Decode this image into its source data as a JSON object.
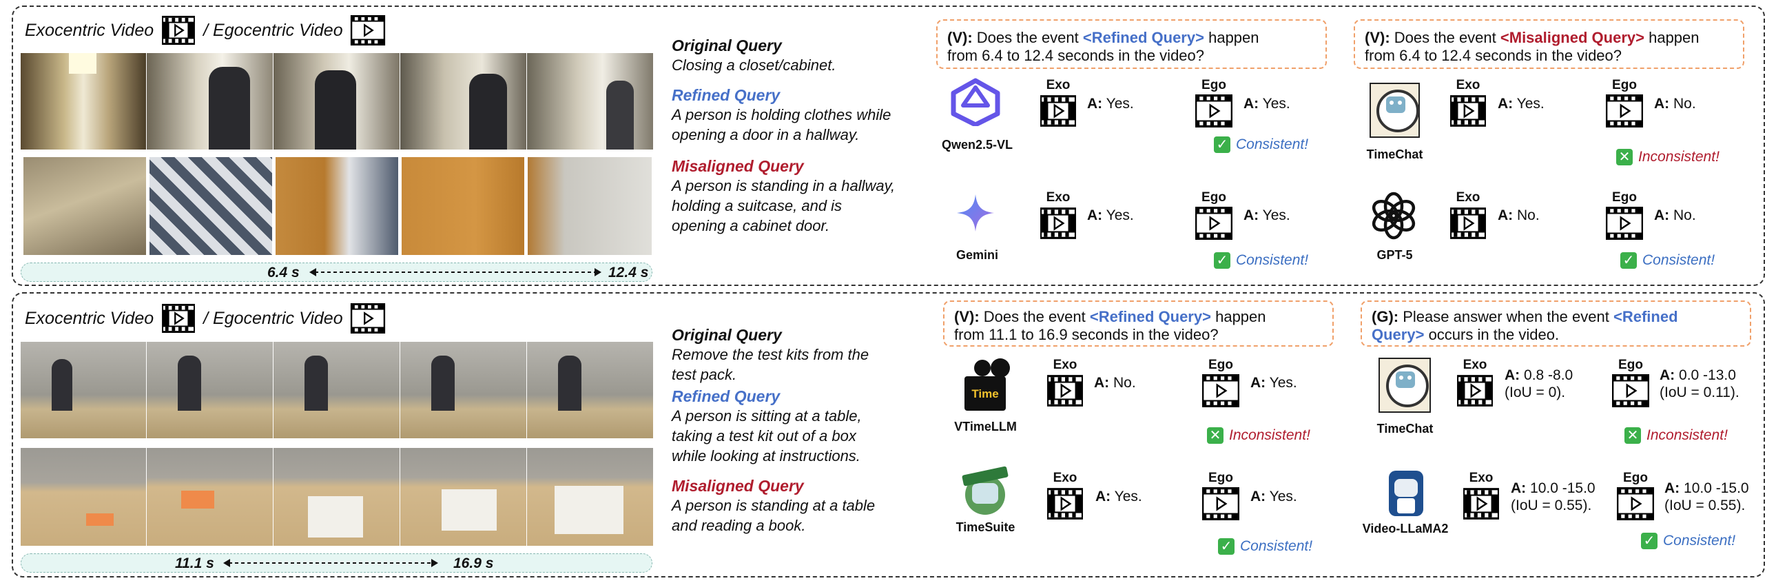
{
  "colors": {
    "refined": "#4670c8",
    "misaligned": "#b01d2e",
    "query_box_border": "#f0a06a",
    "timebar_bg": "#e6f6f3",
    "check_green": "#3bb04a"
  },
  "icons": {
    "video": "clapperboard-play-icon",
    "check": "check-mark-icon",
    "cross": "cross-mark-icon"
  },
  "panels": [
    {
      "header": {
        "exo": "Exocentric Video",
        "ego": "/ Egocentric Video"
      },
      "time": {
        "start": "6.4 s",
        "end": "12.4 s"
      },
      "original": {
        "title": "Original Query",
        "text": [
          "Closing a closet/cabinet."
        ]
      },
      "refined": {
        "title": "Refined Query",
        "text": [
          "A person is holding clothes while",
          "opening a door in a hallway."
        ]
      },
      "misaligned": {
        "title": "Misaligned Query",
        "text": [
          "A person is standing in a hallway,",
          "holding a suitcase, and is",
          "opening a cabinet door."
        ]
      },
      "questions": [
        {
          "prefix": "(V):",
          "pre": "Does the event",
          "tag": "<Refined Query>",
          "tag_type": "refined",
          "post": "happen",
          "line2": "from 6.4 to 12.4 seconds in the video?"
        },
        {
          "prefix": "(V):",
          "pre": "Does the event",
          "tag": "<Misaligned Query>",
          "tag_type": "misaligned",
          "post": "happen",
          "line2": "from 6.4 to 12.4 seconds in the video?"
        }
      ],
      "models": [
        {
          "name": "Qwen2.5-VL",
          "logo": "qwen-logo",
          "exo_answer": "Yes.",
          "ego_answer": "Yes.",
          "verdict": "Consistent!",
          "ok": true
        },
        {
          "name": "Gemini",
          "logo": "gemini-logo",
          "exo_answer": "Yes.",
          "ego_answer": "Yes.",
          "verdict": "Consistent!",
          "ok": true
        },
        {
          "name": "TimeChat",
          "logo": "timechat-logo",
          "exo_answer": "Yes.",
          "ego_answer": "No.",
          "verdict": "Inconsistent!",
          "ok": false
        },
        {
          "name": "GPT-5",
          "logo": "openai-logo",
          "exo_answer": "No.",
          "ego_answer": "No.",
          "verdict": "Consistent!",
          "ok": true
        }
      ]
    },
    {
      "header": {
        "exo": "Exocentric Video",
        "ego": "/ Egocentric Video"
      },
      "time": {
        "start": "11.1 s",
        "end": "16.9 s"
      },
      "original": {
        "title": "Original Query",
        "text": [
          "Remove the test kits from the",
          "test pack."
        ]
      },
      "refined": {
        "title": "Refined Query",
        "text": [
          "A person is sitting at a table,",
          "taking a test kit out of a box",
          "while looking at instructions."
        ]
      },
      "misaligned": {
        "title": "Misaligned Query",
        "text": [
          "A person is standing at a table",
          "and reading a book."
        ]
      },
      "questions": [
        {
          "prefix": "(V):",
          "pre": "Does the event",
          "tag": "<Refined Query>",
          "tag_type": "refined",
          "post": "happen",
          "line2": "from 11.1 to 16.9 seconds in the video?"
        },
        {
          "prefix": "(G):",
          "pre": "Please answer when the event",
          "tag": "<Refined",
          "tag_type": "refined",
          "post": "",
          "line2_tag": "Query>",
          "line2": "occurs in the video."
        }
      ],
      "models": [
        {
          "name": "VTimeLLM",
          "logo": "vtimellm-logo",
          "logo_text": "Time",
          "exo_answer": "No.",
          "ego_answer": "Yes.",
          "verdict": "Inconsistent!",
          "ok": false
        },
        {
          "name": "TimeSuite",
          "logo": "timesuite-logo",
          "exo_answer": "Yes.",
          "ego_answer": "Yes.",
          "verdict": "Consistent!",
          "ok": true
        },
        {
          "name": "TimeChat",
          "logo": "timechat-logo",
          "exo_answer": [
            "0.8 -8.0",
            "(IoU = 0)."
          ],
          "ego_answer": [
            "0.0 -13.0",
            "(IoU = 0.11)."
          ],
          "verdict": "Inconsistent!",
          "ok": false
        },
        {
          "name": "Video-LLaMA2",
          "logo": "videollama-logo",
          "exo_answer": [
            "10.0 -15.0",
            "(IoU = 0.55)."
          ],
          "ego_answer": [
            "10.0 -15.0",
            "(IoU = 0.55)."
          ],
          "verdict": "Consistent!",
          "ok": true
        }
      ]
    }
  ],
  "labels": {
    "exo": "Exo",
    "ego": "Ego",
    "answer": "A:"
  }
}
